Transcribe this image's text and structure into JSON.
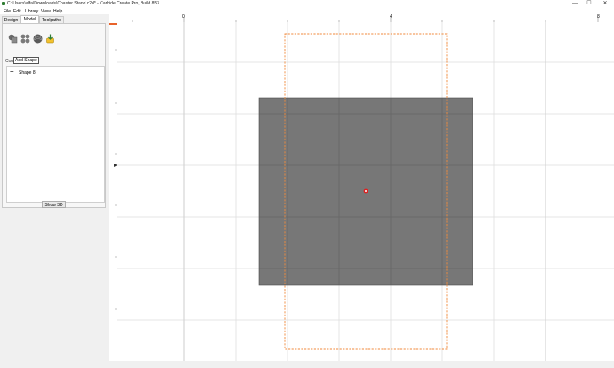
{
  "window": {
    "title": "C:\\Users\\alfa\\Downloads\\Coaster Stand.c2d* - Carbide Create Pro, Build 853",
    "controls": [
      "—",
      "☐",
      "✕"
    ]
  },
  "menu": {
    "items": [
      "File",
      "Edit",
      "Library",
      "View",
      "Help"
    ]
  },
  "tabs": [
    "Design",
    "Model",
    "Toolpaths"
  ],
  "active_tab": "Model",
  "toolbar": {
    "icons": [
      "add-shape-icon",
      "component-icon",
      "texture-sphere-icon",
      "import-model-icon"
    ],
    "tooltip": "Add Shape"
  },
  "panel": {
    "section_label": "Com",
    "tree_items": [
      {
        "label": "Shape 8"
      }
    ],
    "show3d_label": "Show 3D"
  },
  "ruler": {
    "h_labels": [
      "0",
      "4",
      "8"
    ]
  },
  "colors": {
    "shape_fill": "#777777",
    "stock_outline": "#f08a3c",
    "origin_marker": "#e02020",
    "grid_line": "#dcdcdc"
  }
}
